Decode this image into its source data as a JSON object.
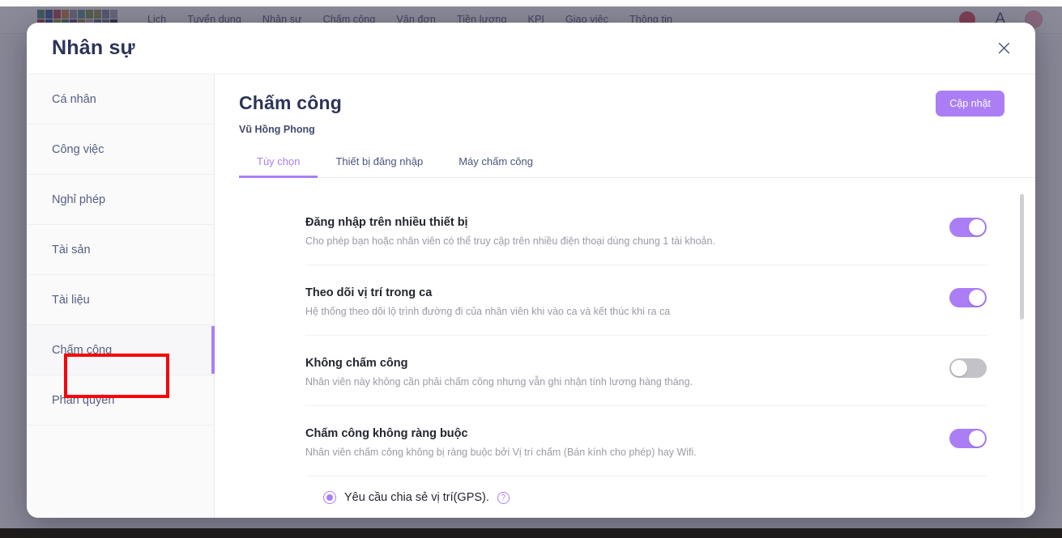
{
  "topnav": {
    "logo_name": "company-logo",
    "logo_colors": [
      "#3f7f6b",
      "#2f4f8f",
      "#b03a45",
      "#c47a3a",
      "#8f9099",
      "#4f8f8f",
      "#6f8f3f",
      "#8f8f3f",
      "#6f7f9f",
      "#9fa0aa",
      "#a0252f",
      "#1f3f8f",
      "#8f8f1f",
      "#2f7f3f",
      "#5f2f7f",
      "#a07a2f",
      "#cf9fa8",
      "#4f5f7f",
      "#5f6f7f",
      "#1a1a2a"
    ],
    "links": [
      "Lịch",
      "Tuyển dụng",
      "Nhân sự",
      "Chấm công",
      "Vận đơn",
      "Tiền lương",
      "KPI",
      "Giao việc",
      "Thông tin"
    ],
    "badge_count": "",
    "letter_icon": "A",
    "avatar_name": "user-avatar"
  },
  "modal": {
    "title": "Nhân sự",
    "close_icon": "close-icon"
  },
  "sidebar": {
    "items": [
      {
        "label": "Cá nhân",
        "active": false
      },
      {
        "label": "Công việc",
        "active": false
      },
      {
        "label": "Nghỉ phép",
        "active": false
      },
      {
        "label": "Tài sản",
        "active": false
      },
      {
        "label": "Tài liệu",
        "active": false
      },
      {
        "label": "Chấm công",
        "active": true
      },
      {
        "label": "Phân quyền",
        "active": false
      }
    ]
  },
  "content": {
    "page_title": "Chấm công",
    "page_subtitle": "Vũ Hồng Phong",
    "update_button": "Cập nhật",
    "tabs": [
      {
        "label": "Tùy chọn",
        "active": true
      },
      {
        "label": "Thiết bị đăng nhập",
        "active": false
      },
      {
        "label": "Máy chấm công",
        "active": false
      }
    ],
    "settings": [
      {
        "title": "Đăng nhập trên nhiều thiết bị",
        "desc": "Cho phép bạn hoặc nhân viên có thể truy cập trên nhiều điện thoại dùng chung 1 tài khoản.",
        "state": "on"
      },
      {
        "title": "Theo dõi vị trí trong ca",
        "desc": "Hệ thống theo dõi lộ trình đường đi của nhân viên khi vào ca và kết thúc khi ra ca",
        "state": "on"
      },
      {
        "title": "Không chấm công",
        "desc": "Nhân viên này không cần phải chấm công nhưng vẫn ghi nhận tính lương hàng tháng.",
        "state": "off"
      },
      {
        "title": "Chấm công không ràng buộc",
        "desc": "Nhân viên chấm công không bị ràng buộc bởi Vị trí chấm (Bán kính cho phép) hay Wifi.",
        "state": "on"
      }
    ],
    "radio_option": {
      "label": "Yêu cầu chia sẻ vị trí(GPS).",
      "selected": true,
      "help_glyph": "?"
    }
  },
  "colors": {
    "accent": "#ab7ef6",
    "title": "#2c3458",
    "annotation": "#fb0007",
    "toggle_off": "#c2c2c7"
  }
}
